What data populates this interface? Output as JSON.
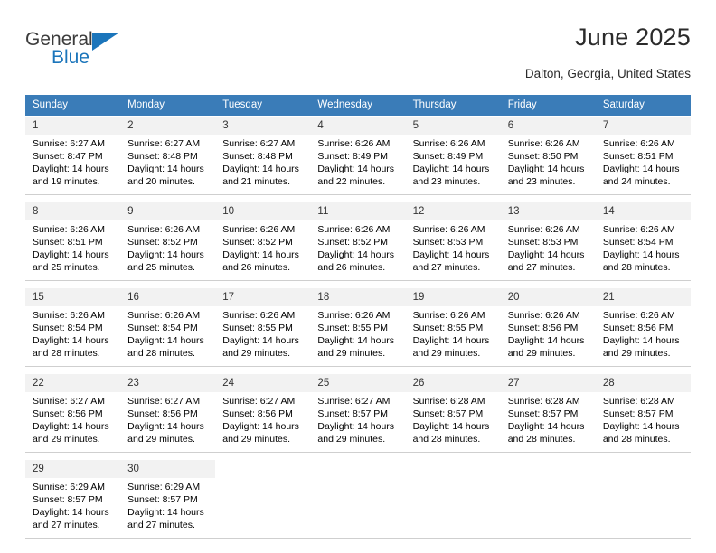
{
  "brand": {
    "name_part1": "General",
    "name_part2": "Blue",
    "triangle_color": "#1b75bb"
  },
  "header": {
    "title": "June 2025",
    "location": "Dalton, Georgia, United States"
  },
  "theme": {
    "header_blue": "#3a7cb8",
    "daynum_band": "#f2f2f2",
    "row_divider": "#cfcfcf"
  },
  "weekdays": [
    "Sunday",
    "Monday",
    "Tuesday",
    "Wednesday",
    "Thursday",
    "Friday",
    "Saturday"
  ],
  "calendar": {
    "weeks": [
      {
        "days": [
          {
            "num": "1",
            "sunrise": "Sunrise: 6:27 AM",
            "sunset": "Sunset: 8:47 PM",
            "daylight1": "Daylight: 14 hours",
            "daylight2": "and 19 minutes."
          },
          {
            "num": "2",
            "sunrise": "Sunrise: 6:27 AM",
            "sunset": "Sunset: 8:48 PM",
            "daylight1": "Daylight: 14 hours",
            "daylight2": "and 20 minutes."
          },
          {
            "num": "3",
            "sunrise": "Sunrise: 6:27 AM",
            "sunset": "Sunset: 8:48 PM",
            "daylight1": "Daylight: 14 hours",
            "daylight2": "and 21 minutes."
          },
          {
            "num": "4",
            "sunrise": "Sunrise: 6:26 AM",
            "sunset": "Sunset: 8:49 PM",
            "daylight1": "Daylight: 14 hours",
            "daylight2": "and 22 minutes."
          },
          {
            "num": "5",
            "sunrise": "Sunrise: 6:26 AM",
            "sunset": "Sunset: 8:49 PM",
            "daylight1": "Daylight: 14 hours",
            "daylight2": "and 23 minutes."
          },
          {
            "num": "6",
            "sunrise": "Sunrise: 6:26 AM",
            "sunset": "Sunset: 8:50 PM",
            "daylight1": "Daylight: 14 hours",
            "daylight2": "and 23 minutes."
          },
          {
            "num": "7",
            "sunrise": "Sunrise: 6:26 AM",
            "sunset": "Sunset: 8:51 PM",
            "daylight1": "Daylight: 14 hours",
            "daylight2": "and 24 minutes."
          }
        ]
      },
      {
        "days": [
          {
            "num": "8",
            "sunrise": "Sunrise: 6:26 AM",
            "sunset": "Sunset: 8:51 PM",
            "daylight1": "Daylight: 14 hours",
            "daylight2": "and 25 minutes."
          },
          {
            "num": "9",
            "sunrise": "Sunrise: 6:26 AM",
            "sunset": "Sunset: 8:52 PM",
            "daylight1": "Daylight: 14 hours",
            "daylight2": "and 25 minutes."
          },
          {
            "num": "10",
            "sunrise": "Sunrise: 6:26 AM",
            "sunset": "Sunset: 8:52 PM",
            "daylight1": "Daylight: 14 hours",
            "daylight2": "and 26 minutes."
          },
          {
            "num": "11",
            "sunrise": "Sunrise: 6:26 AM",
            "sunset": "Sunset: 8:52 PM",
            "daylight1": "Daylight: 14 hours",
            "daylight2": "and 26 minutes."
          },
          {
            "num": "12",
            "sunrise": "Sunrise: 6:26 AM",
            "sunset": "Sunset: 8:53 PM",
            "daylight1": "Daylight: 14 hours",
            "daylight2": "and 27 minutes."
          },
          {
            "num": "13",
            "sunrise": "Sunrise: 6:26 AM",
            "sunset": "Sunset: 8:53 PM",
            "daylight1": "Daylight: 14 hours",
            "daylight2": "and 27 minutes."
          },
          {
            "num": "14",
            "sunrise": "Sunrise: 6:26 AM",
            "sunset": "Sunset: 8:54 PM",
            "daylight1": "Daylight: 14 hours",
            "daylight2": "and 28 minutes."
          }
        ]
      },
      {
        "days": [
          {
            "num": "15",
            "sunrise": "Sunrise: 6:26 AM",
            "sunset": "Sunset: 8:54 PM",
            "daylight1": "Daylight: 14 hours",
            "daylight2": "and 28 minutes."
          },
          {
            "num": "16",
            "sunrise": "Sunrise: 6:26 AM",
            "sunset": "Sunset: 8:54 PM",
            "daylight1": "Daylight: 14 hours",
            "daylight2": "and 28 minutes."
          },
          {
            "num": "17",
            "sunrise": "Sunrise: 6:26 AM",
            "sunset": "Sunset: 8:55 PM",
            "daylight1": "Daylight: 14 hours",
            "daylight2": "and 29 minutes."
          },
          {
            "num": "18",
            "sunrise": "Sunrise: 6:26 AM",
            "sunset": "Sunset: 8:55 PM",
            "daylight1": "Daylight: 14 hours",
            "daylight2": "and 29 minutes."
          },
          {
            "num": "19",
            "sunrise": "Sunrise: 6:26 AM",
            "sunset": "Sunset: 8:55 PM",
            "daylight1": "Daylight: 14 hours",
            "daylight2": "and 29 minutes."
          },
          {
            "num": "20",
            "sunrise": "Sunrise: 6:26 AM",
            "sunset": "Sunset: 8:56 PM",
            "daylight1": "Daylight: 14 hours",
            "daylight2": "and 29 minutes."
          },
          {
            "num": "21",
            "sunrise": "Sunrise: 6:26 AM",
            "sunset": "Sunset: 8:56 PM",
            "daylight1": "Daylight: 14 hours",
            "daylight2": "and 29 minutes."
          }
        ]
      },
      {
        "days": [
          {
            "num": "22",
            "sunrise": "Sunrise: 6:27 AM",
            "sunset": "Sunset: 8:56 PM",
            "daylight1": "Daylight: 14 hours",
            "daylight2": "and 29 minutes."
          },
          {
            "num": "23",
            "sunrise": "Sunrise: 6:27 AM",
            "sunset": "Sunset: 8:56 PM",
            "daylight1": "Daylight: 14 hours",
            "daylight2": "and 29 minutes."
          },
          {
            "num": "24",
            "sunrise": "Sunrise: 6:27 AM",
            "sunset": "Sunset: 8:56 PM",
            "daylight1": "Daylight: 14 hours",
            "daylight2": "and 29 minutes."
          },
          {
            "num": "25",
            "sunrise": "Sunrise: 6:27 AM",
            "sunset": "Sunset: 8:57 PM",
            "daylight1": "Daylight: 14 hours",
            "daylight2": "and 29 minutes."
          },
          {
            "num": "26",
            "sunrise": "Sunrise: 6:28 AM",
            "sunset": "Sunset: 8:57 PM",
            "daylight1": "Daylight: 14 hours",
            "daylight2": "and 28 minutes."
          },
          {
            "num": "27",
            "sunrise": "Sunrise: 6:28 AM",
            "sunset": "Sunset: 8:57 PM",
            "daylight1": "Daylight: 14 hours",
            "daylight2": "and 28 minutes."
          },
          {
            "num": "28",
            "sunrise": "Sunrise: 6:28 AM",
            "sunset": "Sunset: 8:57 PM",
            "daylight1": "Daylight: 14 hours",
            "daylight2": "and 28 minutes."
          }
        ]
      },
      {
        "days": [
          {
            "num": "29",
            "sunrise": "Sunrise: 6:29 AM",
            "sunset": "Sunset: 8:57 PM",
            "daylight1": "Daylight: 14 hours",
            "daylight2": "and 27 minutes."
          },
          {
            "num": "30",
            "sunrise": "Sunrise: 6:29 AM",
            "sunset": "Sunset: 8:57 PM",
            "daylight1": "Daylight: 14 hours",
            "daylight2": "and 27 minutes."
          },
          {
            "num": "",
            "sunrise": "",
            "sunset": "",
            "daylight1": "",
            "daylight2": ""
          },
          {
            "num": "",
            "sunrise": "",
            "sunset": "",
            "daylight1": "",
            "daylight2": ""
          },
          {
            "num": "",
            "sunrise": "",
            "sunset": "",
            "daylight1": "",
            "daylight2": ""
          },
          {
            "num": "",
            "sunrise": "",
            "sunset": "",
            "daylight1": "",
            "daylight2": ""
          },
          {
            "num": "",
            "sunrise": "",
            "sunset": "",
            "daylight1": "",
            "daylight2": ""
          }
        ]
      }
    ]
  }
}
